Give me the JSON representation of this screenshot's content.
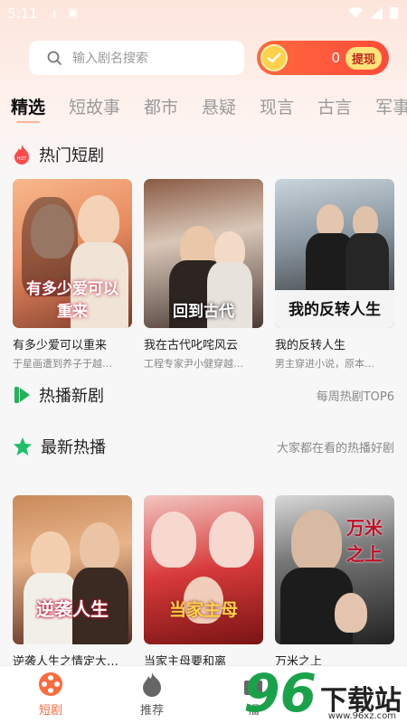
{
  "status_bar": {
    "time": "5:11"
  },
  "search": {
    "placeholder": "输入剧名搜索",
    "icon": "search-icon"
  },
  "coins": {
    "count": "0",
    "withdraw_label": "提现"
  },
  "tabs": [
    {
      "label": "精选",
      "active": true
    },
    {
      "label": "短故事"
    },
    {
      "label": "都市"
    },
    {
      "label": "悬疑"
    },
    {
      "label": "现言"
    },
    {
      "label": "古言"
    },
    {
      "label": "军事"
    }
  ],
  "sections": {
    "hot": {
      "title": "热门短剧",
      "badge": "HOT"
    },
    "new": {
      "title": "热播新剧",
      "more": "每周热剧TOP6"
    },
    "latest": {
      "title": "最新热播",
      "more": "大家都在看的热播好剧"
    }
  },
  "hot_dramas": [
    {
      "name": "有多少爱可以重来",
      "desc": "于星画遭到养子于越…",
      "poster_text": "有多少爱可以重来"
    },
    {
      "name": "我在古代叱咤风云",
      "desc": "工程专家尹小健穿越…",
      "poster_text": "回到古代"
    },
    {
      "name": "我的反转人生",
      "desc": "男主穿进小说，原本…",
      "poster_text": "我的反转人生"
    }
  ],
  "latest_dramas": [
    {
      "name": "逆袭人生之情定大…",
      "poster_text": "逆袭人生"
    },
    {
      "name": "当家主母要和离",
      "poster_text": "当家主母"
    },
    {
      "name": "万米之上",
      "poster_text": "万米之上"
    }
  ],
  "bottom_nav": [
    {
      "label": "短剧",
      "active": true
    },
    {
      "label": "推荐"
    },
    {
      "label": "福"
    }
  ],
  "watermark": {
    "number": "96",
    "text": "下载站",
    "url": "www.96xz.com"
  },
  "colors": {
    "accent": "#ff6a3d",
    "coin_pill": "#ff4a3a",
    "withdraw": "#ffe27a"
  }
}
